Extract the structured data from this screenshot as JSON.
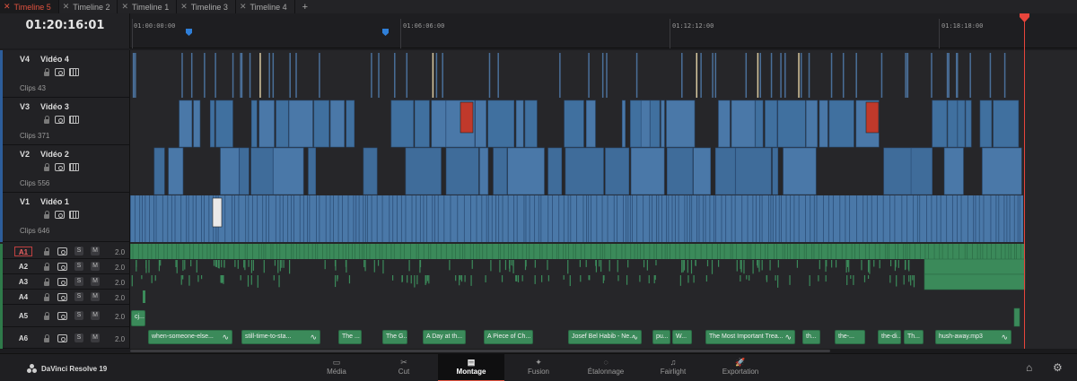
{
  "tabs": [
    {
      "label": "Timeline 5",
      "active": true
    },
    {
      "label": "Timeline 2",
      "active": false
    },
    {
      "label": "Timeline 1",
      "active": false
    },
    {
      "label": "Timeline 3",
      "active": false
    },
    {
      "label": "Timeline 4",
      "active": false
    }
  ],
  "tab_add": "+",
  "timecode": "01:20:16:01",
  "ruler": {
    "ticks": [
      "01:00:00:00",
      "01:06:06:00",
      "01:12:12:00",
      "01:18:18:00"
    ]
  },
  "video_tracks": [
    {
      "code": "V4",
      "name": "Vidéo 4",
      "clips": "Clips 43"
    },
    {
      "code": "V3",
      "name": "Vidéo 3",
      "clips": "Clips 371"
    },
    {
      "code": "V2",
      "name": "Vidéo 2",
      "clips": "Clips 556"
    },
    {
      "code": "V1",
      "name": "Vidéo 1",
      "clips": "Clips 646"
    }
  ],
  "audio_tracks": [
    {
      "code": "A1",
      "volume": "2.0",
      "selected": true
    },
    {
      "code": "A2",
      "volume": "2.0",
      "selected": false
    },
    {
      "code": "A3",
      "volume": "2.0",
      "selected": false
    },
    {
      "code": "A4",
      "volume": "2.0",
      "selected": false
    },
    {
      "code": "A5",
      "volume": "2.0",
      "selected": false
    },
    {
      "code": "A6",
      "volume": "2.0",
      "selected": false
    }
  ],
  "audio_buttons": {
    "solo": "S",
    "mute": "M"
  },
  "a5_clip": "cj...",
  "a6_clips": [
    "when-someone-else...",
    "still-time-to-sta...",
    "The ...",
    "The G...",
    "A Day at th...",
    "A Piece of Ch...",
    "Josef Bel Habib - Ne...",
    "pu...",
    "W...",
    "The Most Important Trea...",
    "th...",
    "the-...",
    "the-di...",
    "Th...",
    "hush-away.mp3"
  ],
  "brand": "DaVinci Resolve 19",
  "pages": [
    {
      "label": "Média",
      "icon": "▭"
    },
    {
      "label": "Cut",
      "icon": "✂"
    },
    {
      "label": "Montage",
      "icon": "▤",
      "active": true
    },
    {
      "label": "Fusion",
      "icon": "✦"
    },
    {
      "label": "Étalonnage",
      "icon": "◌"
    },
    {
      "label": "Fairlight",
      "icon": "♫"
    },
    {
      "label": "Exportation",
      "icon": "🚀"
    }
  ],
  "colors": {
    "video_clip": "#4a78a8",
    "audio_clip": "#3b8a5a",
    "playhead": "#e8453c",
    "active_tab": "#e0533f"
  }
}
